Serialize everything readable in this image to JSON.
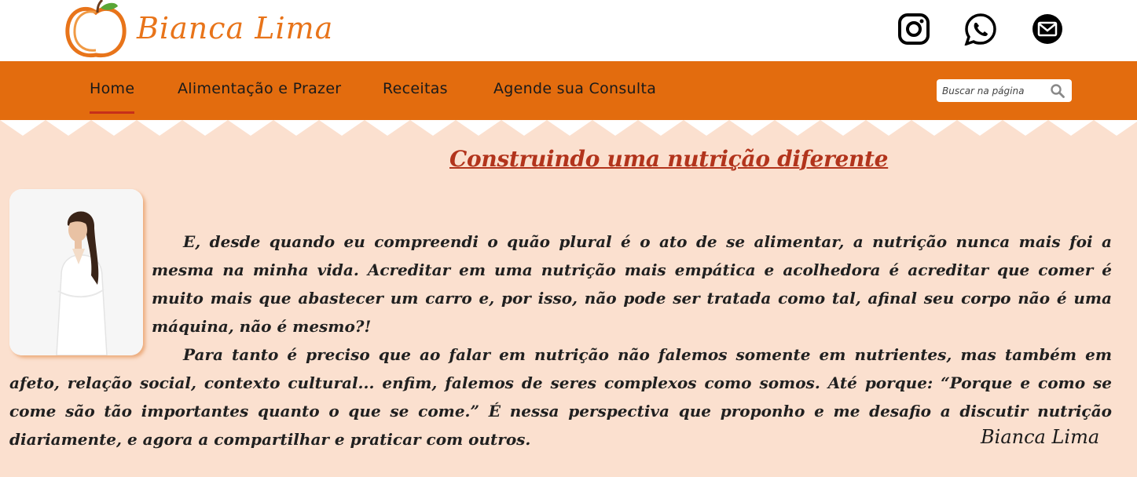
{
  "brand": {
    "name": "Bianca Lima",
    "color": "#e8741a"
  },
  "social": [
    {
      "icon": "instagram-icon"
    },
    {
      "icon": "whatsapp-icon"
    },
    {
      "icon": "email-icon"
    }
  ],
  "nav": {
    "items": [
      {
        "label": "Home",
        "active": true
      },
      {
        "label": "Alimentação e Prazer",
        "active": false
      },
      {
        "label": "Receitas",
        "active": false
      },
      {
        "label": "Agende sua Consulta",
        "active": false
      }
    ],
    "background": "#e36c0e"
  },
  "search": {
    "placeholder": "Buscar na página",
    "icon": "search-icon"
  },
  "main": {
    "title": "Construindo uma nutrição diferente",
    "paragraphs": [
      "E, desde quando eu compreendi o quão plural é o ato de se alimentar, a nutrição nunca mais foi a mesma na minha vida. Acreditar em uma nutrição mais empática e acolhedora é acreditar que comer é muito mais que abastecer um carro e, por isso, não pode ser tratada como tal, afinal seu corpo não é uma máquina, não é mesmo?!",
      "Para tanto é preciso que ao falar em nutrição não falemos somente em nutrientes, mas também em afeto, relação social, contexto cultural... enfim, falemos de seres complexos como somos. Até porque: “Porque e como se come são tão importantes quanto o que se come.” É nessa perspectiva que proponho e me desafio a discutir nutrição diariamente, e agora a compartilhar e praticar com outros."
    ],
    "signature": "Bianca Lima",
    "background": "#fbe0cf",
    "title_color": "#b2341c"
  }
}
